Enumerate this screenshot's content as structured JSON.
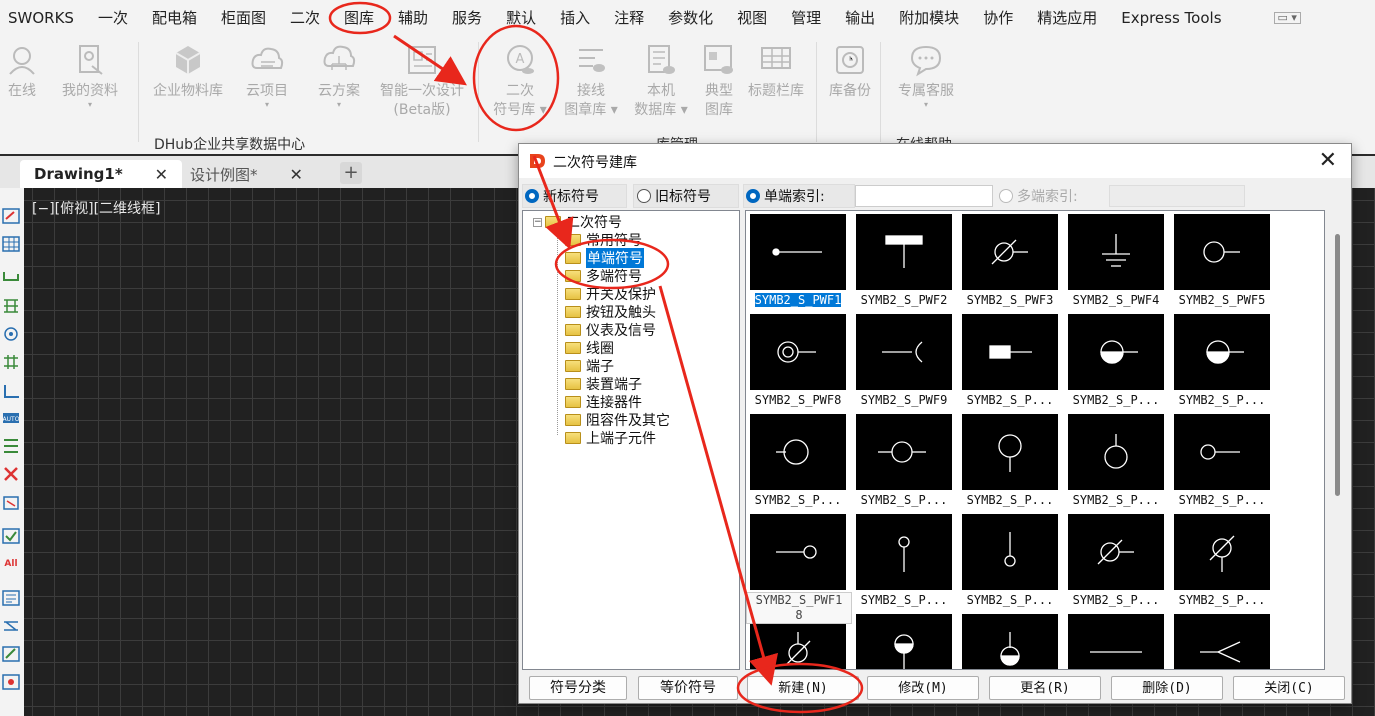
{
  "menubar": {
    "items": [
      "SWORKS",
      "一次",
      "配电箱",
      "柜面图",
      "二次",
      "图库",
      "辅助",
      "服务",
      "默认",
      "插入",
      "注释",
      "参数化",
      "视图",
      "管理",
      "输出",
      "附加模块",
      "协作",
      "精选应用",
      "Express Tools"
    ]
  },
  "ribbon": {
    "buttons": [
      {
        "l1": "在线",
        "l2": ""
      },
      {
        "l1": "我的资料",
        "l2": ""
      },
      {
        "l1": "企业物料库",
        "l2": ""
      },
      {
        "l1": "云项目",
        "l2": ""
      },
      {
        "l1": "云方案",
        "l2": ""
      },
      {
        "l1": "智能一次设计",
        "l2": "(Beta版)"
      },
      {
        "l1": "二次",
        "l2": "符号库"
      },
      {
        "l1": "接线",
        "l2": "图章库"
      },
      {
        "l1": "本机",
        "l2": "数据库"
      },
      {
        "l1": "典型",
        "l2": "图库"
      },
      {
        "l1": "标题栏库",
        "l2": ""
      },
      {
        "l1": "库备份",
        "l2": ""
      },
      {
        "l1": "专属客服",
        "l2": ""
      }
    ],
    "groups": [
      "DHub企业共享数据中心",
      "库管理",
      "在线帮助"
    ]
  },
  "tabs": [
    {
      "label": "Drawing1*",
      "close": "✕"
    },
    {
      "label": "设计例图*",
      "close": "✕"
    }
  ],
  "tab_add": "+",
  "viewport": {
    "label": "[−][俯视][二维线框]"
  },
  "dialog": {
    "title": "二次符号建库",
    "close": "✕",
    "radios": {
      "new_symbol": "新标符号",
      "old_symbol": "旧标符号",
      "single_index": "单端索引:",
      "multi_index": "多端索引:"
    },
    "tree": {
      "root": "二次符号",
      "expander": "−",
      "children": [
        "常用符号",
        "单端符号",
        "多端符号",
        "开关及保护",
        "按钮及触头",
        "仪表及信号",
        "线圈",
        "端子",
        "装置端子",
        "连接器件",
        "阻容件及其它",
        "上端子元件"
      ],
      "selected_index": 1
    },
    "symbols": [
      {
        "caption": "SYMB2_S_PWF1",
        "glyph": "dot-line"
      },
      {
        "caption": "SYMB2_S_PWF2",
        "glyph": "t-bar"
      },
      {
        "caption": "SYMB2_S_PWF3",
        "glyph": "circle-slash-line"
      },
      {
        "caption": "SYMB2_S_PWF4",
        "glyph": "ground"
      },
      {
        "caption": "SYMB2_S_PWF5",
        "glyph": "circle-line-right"
      },
      {
        "caption": "SYMB2_S_PWF8",
        "glyph": "double-circle-line"
      },
      {
        "caption": "SYMB2_S_PWF9",
        "glyph": "line-arc"
      },
      {
        "caption": "SYMB2_S_P...",
        "glyph": "rect-line"
      },
      {
        "caption": "SYMB2_S_P...",
        "glyph": "half-circle-line"
      },
      {
        "caption": "SYMB2_S_P...",
        "glyph": "half-circle-line"
      },
      {
        "caption": "SYMB2_S_P...",
        "glyph": "circle-line-left"
      },
      {
        "caption": "SYMB2_S_P...",
        "glyph": "circle-both"
      },
      {
        "caption": "SYMB2_S_P...",
        "glyph": "circle-down"
      },
      {
        "caption": "SYMB2_S_P...",
        "glyph": "circle-up"
      },
      {
        "caption": "SYMB2_S_P...",
        "glyph": "small-circle-line"
      },
      {
        "caption": "SYMB2_S_PWF18",
        "glyph": "line-small-circle"
      },
      {
        "caption": "SYMB2_S_P...",
        "glyph": "pin-down"
      },
      {
        "caption": "SYMB2_S_P...",
        "glyph": "pin-up"
      },
      {
        "caption": "SYMB2_S_P...",
        "glyph": "circle-slash-line"
      },
      {
        "caption": "SYMB2_S_P...",
        "glyph": "circle-slash-down"
      },
      {
        "caption": "",
        "glyph": "circle-slash-up"
      },
      {
        "caption": "",
        "glyph": "half-circle-down"
      },
      {
        "caption": "",
        "glyph": "half-circle-up"
      },
      {
        "caption": "",
        "glyph": "hline"
      },
      {
        "caption": "",
        "glyph": "fork"
      }
    ],
    "tooltip": {
      "line1": "SYMB2_S_PWF1",
      "line2": "8"
    },
    "buttons": {
      "classify": "符号分类",
      "equivalent": "等价符号",
      "new": "新建(N)",
      "modify": "修改(M)",
      "rename": "更名(R)",
      "delete": "删除(D)",
      "close": "关闭(C)"
    }
  },
  "colors": {
    "annotation": "#e8271c",
    "selection": "#0078d7"
  }
}
